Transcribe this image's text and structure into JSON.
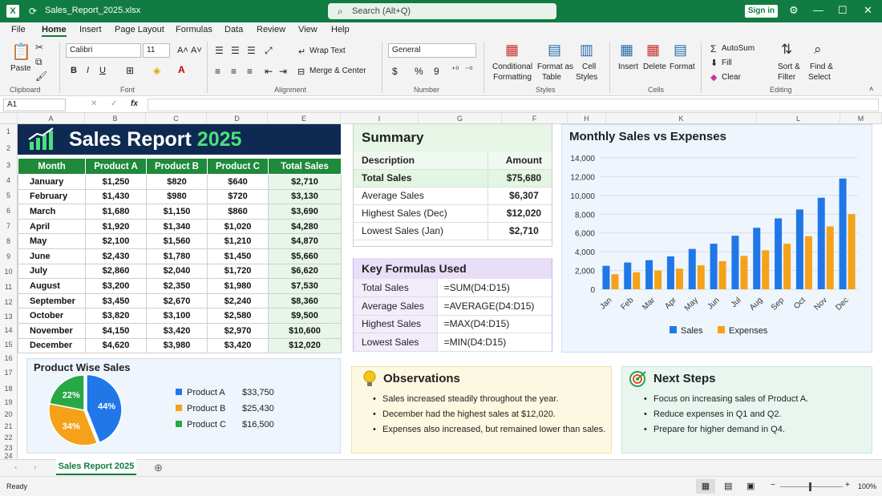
{
  "titlebar": {
    "app_icon": "X",
    "filename": "Sales_Report_2025.xlsx",
    "search_placeholder": "Search (Alt+Q)",
    "signin": "Sign in"
  },
  "menu": [
    "File",
    "Home",
    "Insert",
    "Page Layout",
    "Formulas",
    "Data",
    "Review",
    "View",
    "Help"
  ],
  "ribbon": {
    "clipboard": {
      "paste": "Paste",
      "label": "Clipboard"
    },
    "font": {
      "name": "Calibri",
      "size": "11",
      "label": "Font",
      "bold": "B",
      "italic": "I",
      "underline": "U"
    },
    "alignment": {
      "wrap": "Wrap Text",
      "merge": "Merge & Center",
      "label": "Alignment"
    },
    "number": {
      "format": "General",
      "currency": "$",
      "percent": "%",
      "comma": "9",
      "label": "Number"
    },
    "styles": {
      "conditional": [
        "Conditional",
        "Formatting"
      ],
      "format_table": [
        "Format as",
        "Table"
      ],
      "cell_styles": [
        "Cell",
        "Styles"
      ],
      "label": "Styles"
    },
    "cells": {
      "insert": "Insert",
      "delete": "Delete",
      "format": "Format",
      "label": "Cells"
    },
    "editing": {
      "autosum": "AutoSum",
      "fill": "Fill",
      "clear": "Clear",
      "sort": [
        "Sort &",
        "Filter"
      ],
      "find": [
        "Find &",
        "Select"
      ],
      "label": "Editing"
    }
  },
  "formula_bar": {
    "cell_ref": "A1",
    "fx": "fx",
    "cancel": "✕",
    "enter": "✓"
  },
  "columns": [
    "A",
    "B",
    "C",
    "D",
    "E",
    "I",
    "G",
    "F",
    "H",
    "K",
    "L",
    "M"
  ],
  "rows": [
    "1",
    "2",
    "3",
    "4",
    "5",
    "6",
    "7",
    "8",
    "9",
    "10",
    "11",
    "12",
    "13",
    "14",
    "15",
    "16",
    "17",
    "18",
    "19",
    "20",
    "21",
    "22",
    "23",
    "24"
  ],
  "report": {
    "title": "Sales Report",
    "year": "2025"
  },
  "sales_table": {
    "headers": [
      "Month",
      "Product A",
      "Product B",
      "Product C",
      "Total Sales"
    ],
    "rows": [
      [
        "January",
        "$1,250",
        "$820",
        "$640",
        "$2,710"
      ],
      [
        "February",
        "$1,430",
        "$980",
        "$720",
        "$3,130"
      ],
      [
        "March",
        "$1,680",
        "$1,150",
        "$860",
        "$3,690"
      ],
      [
        "April",
        "$1,920",
        "$1,340",
        "$1,020",
        "$4,280"
      ],
      [
        "May",
        "$2,100",
        "$1,560",
        "$1,210",
        "$4,870"
      ],
      [
        "June",
        "$2,430",
        "$1,780",
        "$1,450",
        "$5,660"
      ],
      [
        "July",
        "$2,860",
        "$2,040",
        "$1,720",
        "$6,620"
      ],
      [
        "August",
        "$3,200",
        "$2,350",
        "$1,980",
        "$7,530"
      ],
      [
        "September",
        "$3,450",
        "$2,670",
        "$2,240",
        "$8,360"
      ],
      [
        "October",
        "$3,820",
        "$3,100",
        "$2,580",
        "$9,500"
      ],
      [
        "November",
        "$4,150",
        "$3,420",
        "$2,970",
        "$10,600"
      ],
      [
        "December",
        "$4,620",
        "$3,980",
        "$3,420",
        "$12,020"
      ]
    ]
  },
  "summary": {
    "title": "Summary",
    "headers": [
      "Description",
      "Amount"
    ],
    "rows": [
      [
        "Total Sales",
        "$75,680"
      ],
      [
        "Average Sales",
        "$6,307"
      ],
      [
        "Highest Sales (Dec)",
        "$12,020"
      ],
      [
        "Lowest Sales (Jan)",
        "$2,710"
      ]
    ]
  },
  "formulas": {
    "title": "Key Formulas Used",
    "rows": [
      [
        "Total Sales",
        "=SUM(D4:D15)"
      ],
      [
        "Average Sales",
        "=AVERAGE(D4:D15)"
      ],
      [
        "Highest Sales",
        "=MAX(D4:D15)"
      ],
      [
        "Lowest Sales",
        "=MIN(D4:D15)"
      ]
    ]
  },
  "chart_data": [
    {
      "type": "bar",
      "title": "Monthly Sales vs Expenses",
      "categories": [
        "Jan",
        "Feb",
        "Mar",
        "Apr",
        "May",
        "Jun",
        "Jul",
        "Aug",
        "Sep",
        "Oct",
        "Nov",
        "Dec"
      ],
      "series": [
        {
          "name": "Sales",
          "color": "#1f77e8",
          "values": [
            2500,
            2850,
            3100,
            3500,
            4300,
            4850,
            5700,
            6550,
            7550,
            8500,
            9750,
            11800
          ]
        },
        {
          "name": "Expenses",
          "color": "#f5a21a",
          "values": [
            1600,
            1800,
            2000,
            2200,
            2550,
            3000,
            3550,
            4150,
            4850,
            5650,
            6700,
            8000
          ]
        }
      ],
      "ylim": [
        0,
        14000
      ],
      "yticks": [
        "0",
        "2,000",
        "4,000",
        "6,000",
        "8,000",
        "10,000",
        "12,000",
        "14,000"
      ],
      "legend": "bottom"
    },
    {
      "type": "pie",
      "title": "Product Wise Sales",
      "labels": [
        "Product A",
        "Product B",
        "Product C"
      ],
      "values": [
        44,
        34,
        22
      ],
      "value_labels": [
        "44%",
        "34%",
        "22%"
      ],
      "amounts": [
        "$33,750",
        "$25,430",
        "$16,500"
      ],
      "colors": [
        "#1f77e8",
        "#f5a21a",
        "#28a745"
      ]
    }
  ],
  "observations": {
    "title": "Observations",
    "items": [
      "Sales increased steadily throughout the year.",
      "December had the highest sales at $12,020.",
      "Expenses also increased, but remained lower than sales."
    ]
  },
  "next_steps": {
    "title": "Next Steps",
    "items": [
      "Focus on increasing sales of Product A.",
      "Reduce expenses in Q1 and Q2.",
      "Prepare for higher demand in Q4."
    ]
  },
  "sheet_tab": "Sales Report 2025",
  "status": {
    "ready": "Ready",
    "zoom": "100%"
  }
}
